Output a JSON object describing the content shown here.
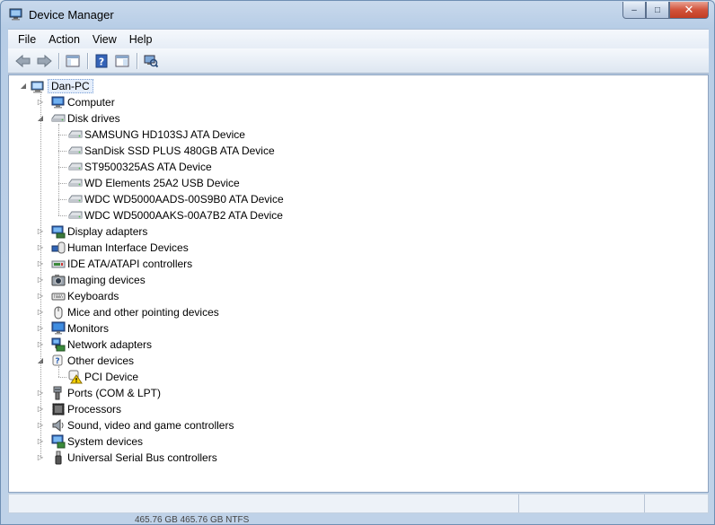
{
  "window": {
    "title": "Device Manager",
    "minimize_glyph": "‒",
    "maximize_glyph": "□",
    "close_glyph": "✕"
  },
  "menu": [
    "File",
    "Action",
    "View",
    "Help"
  ],
  "toolbar": {
    "buttons": [
      "back-icon",
      "forward-icon",
      "show-hide-console-tree-icon",
      "help-icon",
      "properties-icon",
      "scan-hardware-changes-icon"
    ]
  },
  "tree": {
    "root": "Dan-PC",
    "categories": [
      {
        "label": "Computer",
        "icon": "computer-icon",
        "expanded": false
      },
      {
        "label": "Disk drives",
        "icon": "disk-drive-icon",
        "expanded": true,
        "children": [
          "SAMSUNG HD103SJ ATA Device",
          "SanDisk SSD PLUS 480GB ATA Device",
          "ST9500325AS ATA Device",
          "WD Elements 25A2 USB Device",
          "WDC WD5000AADS-00S9B0 ATA Device",
          "WDC WD5000AAKS-00A7B2 ATA Device"
        ]
      },
      {
        "label": "Display adapters",
        "icon": "display-adapter-icon",
        "expanded": false
      },
      {
        "label": "Human Interface Devices",
        "icon": "hid-icon",
        "expanded": false
      },
      {
        "label": "IDE ATA/ATAPI controllers",
        "icon": "ide-controller-icon",
        "expanded": false
      },
      {
        "label": "Imaging devices",
        "icon": "camera-icon",
        "expanded": false
      },
      {
        "label": "Keyboards",
        "icon": "keyboard-icon",
        "expanded": false
      },
      {
        "label": "Mice and other pointing devices",
        "icon": "mouse-icon",
        "expanded": false
      },
      {
        "label": "Monitors",
        "icon": "monitor-icon",
        "expanded": false
      },
      {
        "label": "Network adapters",
        "icon": "network-adapter-icon",
        "expanded": false
      },
      {
        "label": "Other devices",
        "icon": "unknown-device-icon",
        "expanded": true,
        "children": [
          "PCI Device"
        ]
      },
      {
        "label": "Ports (COM & LPT)",
        "icon": "port-icon",
        "expanded": false
      },
      {
        "label": "Processors",
        "icon": "processor-icon",
        "expanded": false
      },
      {
        "label": "Sound, video and game controllers",
        "icon": "speaker-icon",
        "expanded": false
      },
      {
        "label": "System devices",
        "icon": "system-device-icon",
        "expanded": false
      },
      {
        "label": "Universal Serial Bus controllers",
        "icon": "usb-icon",
        "expanded": false
      }
    ]
  },
  "background_text": "465.76 GB          465.76 GB NTFS"
}
